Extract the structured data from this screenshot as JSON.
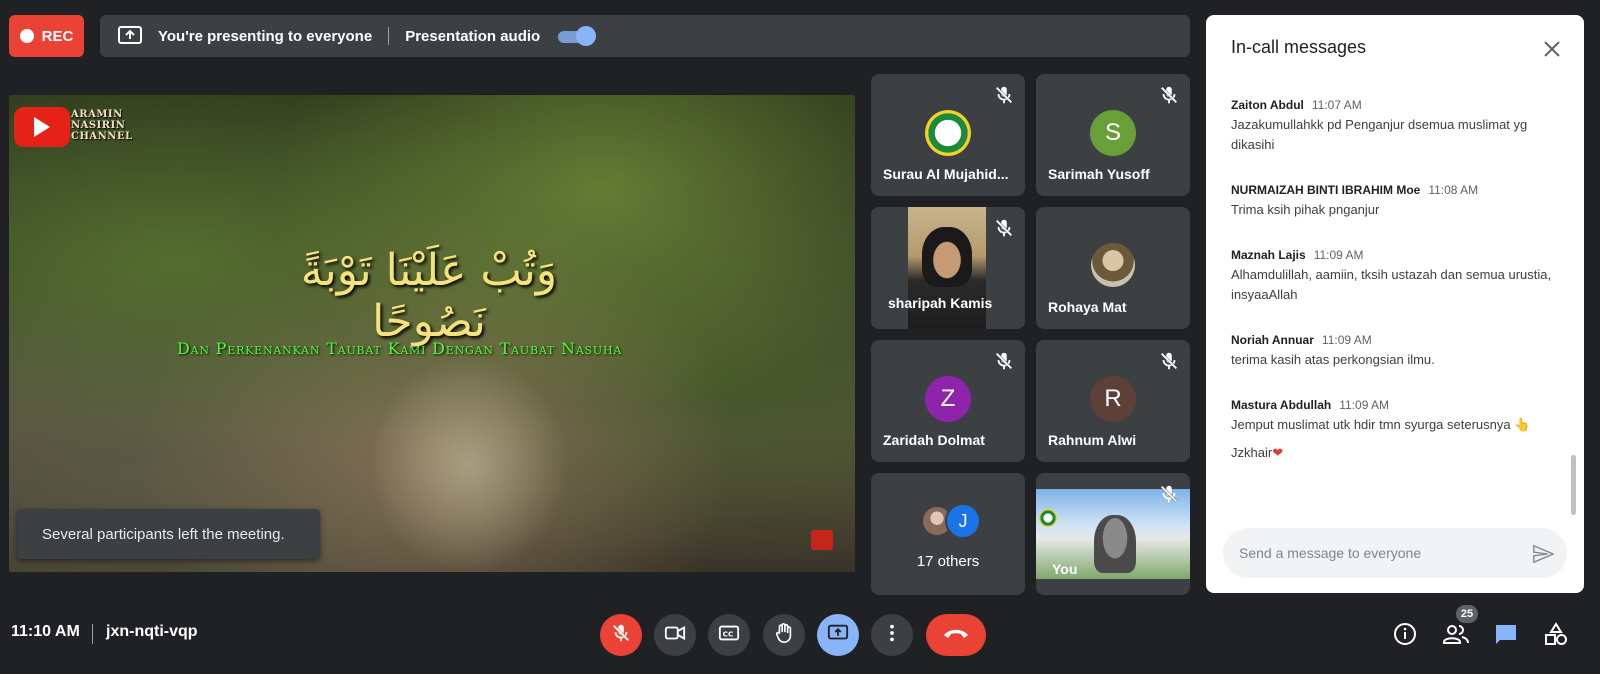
{
  "top_bar": {
    "rec_label": "REC",
    "presenting_text": "You're presenting to everyone",
    "presentation_audio_label": "Presentation audio",
    "presentation_audio_on": true
  },
  "presentation": {
    "channel_name": "ARAMIN NASIRIN CHANNEL",
    "arabic_text": "وَتُبْ عَلَيْنَا تَوْبَةً نَصُوحًا",
    "translation": "Dan Perkenankan Taubat Kami Dengan Taubat Nasuha",
    "toast": "Several participants left the meeting."
  },
  "participants": [
    {
      "name": "Surau Al Mujahid...",
      "type": "logo",
      "muted": true
    },
    {
      "name": "Sarimah Yusoff",
      "initial": "S",
      "color": "#689f38",
      "muted": true
    },
    {
      "name": "sharipah Kamis",
      "type": "camera",
      "muted": true
    },
    {
      "name": "Rohaya Mat",
      "type": "photo",
      "muted": false
    },
    {
      "name": "Zaridah Dolmat",
      "initial": "Z",
      "color": "#8e24aa",
      "muted": true
    },
    {
      "name": "Rahnum Alwi",
      "initial": "R",
      "color": "#5d4037",
      "muted": true
    },
    {
      "name": "17 others",
      "type": "others",
      "initial": "J",
      "color": "#1a73e8"
    },
    {
      "name": "You",
      "type": "camera",
      "muted": true
    }
  ],
  "chat": {
    "title": "In-call messages",
    "messages": [
      {
        "sender": "Zaiton Abdul",
        "time": "11:07 AM",
        "text": "Jazakumullahkk pd Penganjur dsemua  muslimat yg dikasihi"
      },
      {
        "sender": "NURMAIZAH BINTI IBRAHIM Moe",
        "time": "11:08 AM",
        "text": "Trima ksih pihak pnganjur"
      },
      {
        "sender": "Maznah Lajis",
        "time": "11:09 AM",
        "text": "Alhamdulillah, aamiin, tksih ustazah dan semua urustia, insyaaAllah"
      },
      {
        "sender": "Noriah Annuar",
        "time": "11:09 AM",
        "text": "terima kasih atas perkongsian ilmu."
      },
      {
        "sender": "Mastura Abdullah",
        "time": "11:09 AM",
        "text": "Jemput muslimat utk hdir tmn syurga seterusnya 👆",
        "extra": "Jzkhair"
      }
    ],
    "input_placeholder": "Send a message to everyone"
  },
  "bottom_bar": {
    "time": "11:10 AM",
    "meeting_code": "jxn-nqti-vqp",
    "participant_count": "25"
  },
  "colors": {
    "background": "#202124",
    "tile": "#3c4043",
    "red": "#ea4335",
    "blue_accent": "#8ab4f8"
  }
}
